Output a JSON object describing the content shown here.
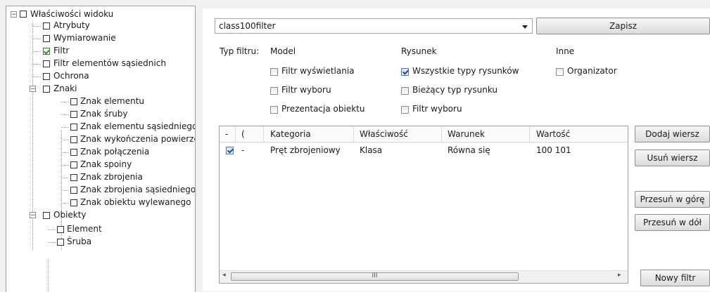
{
  "tree": {
    "root_label": "Właściwości widoku",
    "items": {
      "atrybuty": "Atrybuty",
      "wymiarowanie": "Wymiarowanie",
      "filtr": "Filtr",
      "filtr_sasiednich": "Filtr elementów sąsiednich",
      "ochrona": "Ochrona",
      "znaki": "Znaki",
      "znak_elementu": "Znak elementu",
      "znak_sruby": "Znak śruby",
      "znak_elementu_sasiedniego": "Znak elementu sąsiedniego",
      "znak_wykonczenia": "Znak wykończenia powierzc",
      "znak_polaczenia": "Znak połączenia",
      "znak_spoiny": "Znak spoiny",
      "znak_zbrojenia": "Znak zbrojenia",
      "znak_zbrojenia_sasiedniego": "Znak zbrojenia sąsiedniego",
      "znak_obiektu_wylewanego": "Znak obiektu wylewanego",
      "obiekty": "Obiekty",
      "element": "Element",
      "sruba": "Śruba"
    },
    "checked": "Filtr"
  },
  "filter": {
    "selected": "class100filter",
    "save_label": "Zapisz"
  },
  "filter_type": {
    "label": "Typ filtru:",
    "groups": {
      "model": "Model",
      "rysunek": "Rysunek",
      "inne": "Inne"
    },
    "options": {
      "filtr_wyswietlania": "Filtr wyświetlania",
      "filtr_wyboru_model": "Filtr wyboru",
      "prezentacja_obiektu": "Prezentacja obiektu",
      "wszystkie_typy": "Wszystkie typy rysunków",
      "biezacy_typ": "Bieżący typ rysunku",
      "filtr_wyboru_rysunek": "Filtr wyboru",
      "organizator": "Organizator"
    },
    "checked": [
      "Wszystkie typy rysunków"
    ]
  },
  "grid": {
    "headers": [
      "-",
      "(",
      "Kategoria",
      "Właściwość",
      "Warunek",
      "Wartość"
    ],
    "rows": [
      {
        "checked": true,
        "dash": "-",
        "kategoria": "Pręt zbrojeniowy",
        "wlasciwosc": "Klasa",
        "warunek": "Równa się",
        "wartosc": "100 101"
      }
    ],
    "scroll_thumb": "III"
  },
  "buttons": {
    "dodaj": "Dodaj wiersz",
    "usun": "Usuń wiersz",
    "gore": "Przesuń w górę",
    "dol": "Przesuń w dół",
    "nowy": "Nowy filtr"
  }
}
